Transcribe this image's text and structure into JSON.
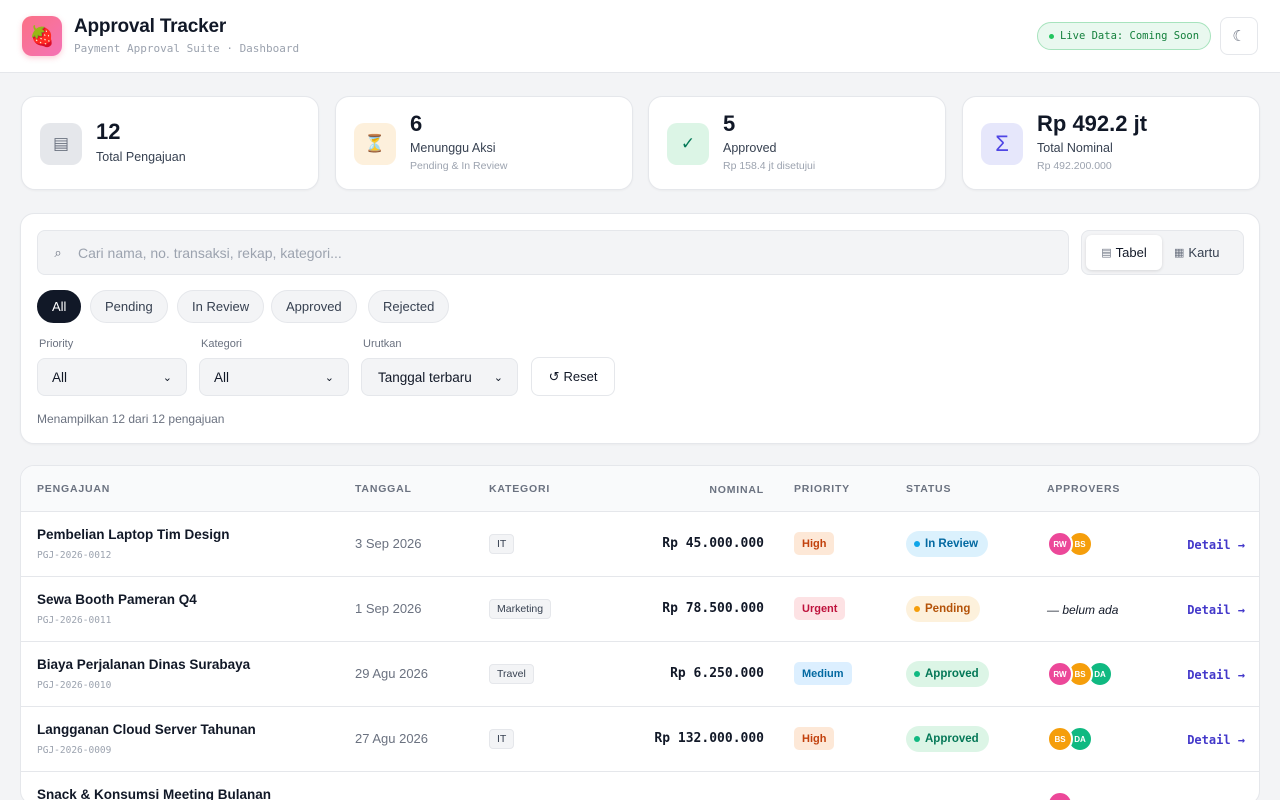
{
  "header": {
    "logo_icon": "strawberry-icon",
    "title": "Approval Tracker",
    "subtitle": "Payment Approval Suite · Dashboard",
    "live_badge": "Live Data: Coming Soon",
    "theme_icon": "☾"
  },
  "stats": [
    {
      "icon": "▤",
      "value": "12",
      "label": "Total Pengajuan",
      "sub": "",
      "icon_bg": "#e5e7eb",
      "icon_color": "#6b7280"
    },
    {
      "icon": "⏳",
      "value": "6",
      "label": "Menunggu Aksi",
      "sub": "Pending & In Review",
      "icon_bg": "#fdf0dc",
      "icon_color": "#b45309"
    },
    {
      "icon": "✓",
      "value": "5",
      "label": "Approved",
      "sub": "Rp 158.4 jt disetujui",
      "icon_bg": "#dcf5e6",
      "icon_color": "#047857"
    },
    {
      "icon": "Σ",
      "value": "Rp 492.2 jt",
      "label": "Total Nominal",
      "sub": "Rp 492.200.000",
      "icon_bg": "#e6e7fb",
      "icon_color": "#4f46e5"
    }
  ],
  "filters": {
    "search_placeholder": "Cari nama, no. transaksi, rekap, kategori...",
    "search_icon": "⌕",
    "view_table_label": "Tabel",
    "view_card_label": "Kartu",
    "chips": [
      "All",
      "Pending",
      "In Review",
      "Approved",
      "Rejected"
    ],
    "priority_label": "Priority",
    "priority_value": "All",
    "category_label": "Kategori",
    "category_value": "All",
    "sort_label": "Urutkan",
    "sort_value": "Tanggal terbaru",
    "reset_label": "Reset",
    "result_count": "Menampilkan 12 dari 12 pengajuan"
  },
  "table": {
    "headers": [
      "PENGAJUAN",
      "TANGGAL",
      "KATEGORI",
      "NOMINAL",
      "PRIORITY",
      "STATUS",
      "APPROVERS"
    ],
    "detail_label": "Detail →",
    "rows": [
      {
        "title": "Pembelian Laptop Tim Design",
        "id": "PGJ-2026-0012",
        "date": "3 Sep 2026",
        "category": "IT",
        "amount": "Rp 45.000.000",
        "priority": "High",
        "status": "In Review",
        "approvers": [
          "RW",
          "BS"
        ],
        "none_text": ""
      },
      {
        "title": "Sewa Booth Pameran Q4",
        "id": "PGJ-2026-0011",
        "date": "1 Sep 2026",
        "category": "Marketing",
        "amount": "Rp 78.500.000",
        "priority": "Urgent",
        "status": "Pending",
        "approvers": [],
        "none_text": "— belum ada"
      },
      {
        "title": "Biaya Perjalanan Dinas Surabaya",
        "id": "PGJ-2026-0010",
        "date": "29 Agu 2026",
        "category": "Travel",
        "amount": "Rp 6.250.000",
        "priority": "Medium",
        "status": "Approved",
        "approvers": [
          "RW",
          "BS",
          "DA"
        ],
        "none_text": ""
      },
      {
        "title": "Langganan Cloud Server Tahunan",
        "id": "PGJ-2026-0009",
        "date": "27 Agu 2026",
        "category": "IT",
        "amount": "Rp 132.000.000",
        "priority": "High",
        "status": "Approved",
        "approvers": [
          "BS",
          "DA"
        ],
        "none_text": ""
      },
      {
        "title": "Snack & Konsumsi Meeting Bulanan",
        "id": "",
        "date": "",
        "category": "",
        "amount": "",
        "priority": "",
        "status": "",
        "approvers": [
          "RW"
        ],
        "none_text": ""
      }
    ]
  },
  "colors": {
    "avatar_RW": "#ec4899",
    "avatar_BS": "#f59e0b",
    "avatar_DA": "#10b981",
    "priority_High_bg": "#fde8d7",
    "priority_High_fg": "#c2410c",
    "priority_Urgent_bg": "#fde2e4",
    "priority_Urgent_fg": "#be123c",
    "priority_Medium_bg": "#dcefff",
    "priority_Medium_fg": "#0369a1",
    "status_In Review_bg": "#dbf1fd",
    "status_In Review_fg": "#0369a1",
    "status_In Review_dot": "#0ea5e9",
    "status_Pending_bg": "#fdf1dc",
    "status_Pending_fg": "#b45309",
    "status_Pending_dot": "#f59e0b",
    "status_Approved_bg": "#dcf5e6",
    "status_Approved_fg": "#047857",
    "status_Approved_dot": "#10b981"
  }
}
